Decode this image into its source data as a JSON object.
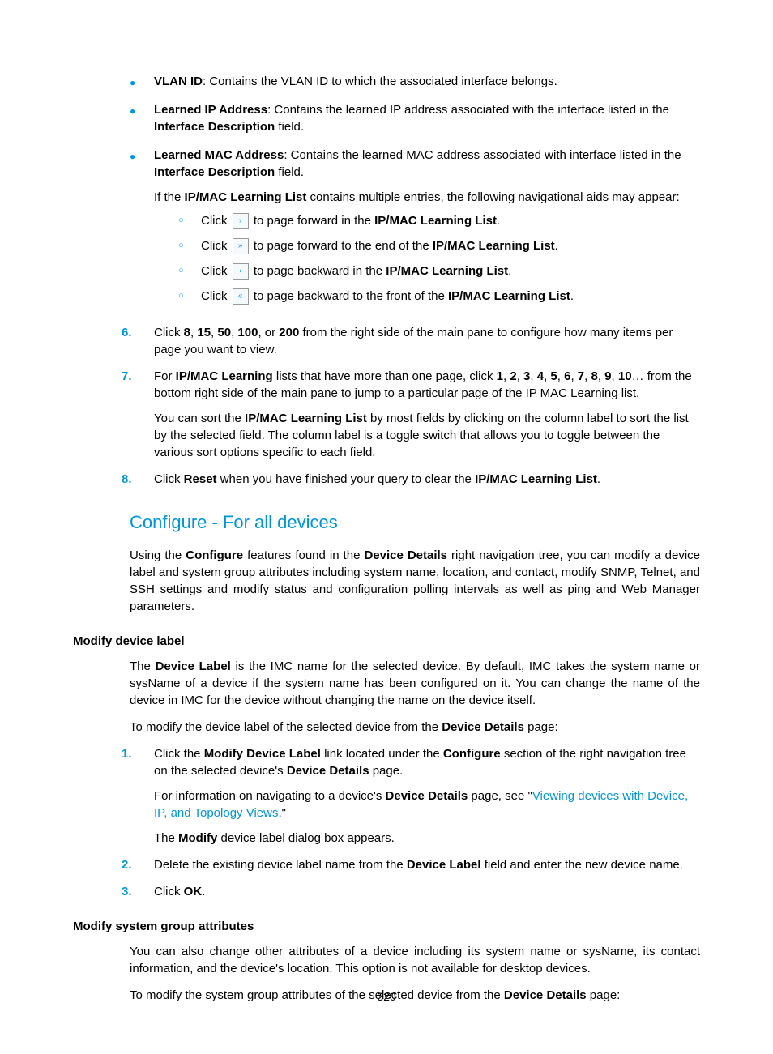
{
  "topBullets": [
    {
      "term": "VLAN ID",
      "desc": ": Contains the VLAN ID to which the associated interface belongs."
    },
    {
      "term": "Learned IP Address",
      "desc": ": Contains the learned IP address associated with the interface listed in the ",
      "tail": " field.",
      "tailBold": "Interface Description"
    },
    {
      "term": "Learned MAC Address",
      "desc": ": Contains the learned MAC address associated with interface listed in the ",
      "tail": " field.",
      "tailBold": "Interface Description"
    }
  ],
  "navIntro": {
    "pre": "If the ",
    "bold": "IP/MAC Learning List",
    "post": " contains multiple entries, the following navigational aids may appear:"
  },
  "navItems": [
    {
      "clickWord": "Click ",
      "iconGlyph": "›",
      "mid": " to page forward in the ",
      "bold": "IP/MAC Learning List",
      "end": "."
    },
    {
      "clickWord": "Click ",
      "iconGlyph": "»",
      "mid": " to page forward to the end of the ",
      "bold": "IP/MAC Learning List",
      "end": "."
    },
    {
      "clickWord": "Click ",
      "iconGlyph": "‹",
      "mid": " to page backward in the ",
      "bold": "IP/MAC Learning List",
      "end": "."
    },
    {
      "clickWord": "Click ",
      "iconGlyph": "«",
      "mid": " to page backward to the front of the ",
      "bold": "IP/MAC Learning List",
      "end": "."
    }
  ],
  "step6": {
    "num": "6.",
    "pre": "Click ",
    "nums": [
      "8",
      "15",
      "50",
      "100",
      "200"
    ],
    "or": ", or ",
    "post": " from the right side of the main pane to configure how many items per page you want to view."
  },
  "step7": {
    "num": "7.",
    "pre": "For ",
    "bold1": "IP/MAC Learning",
    "mid1": " lists that have more than one page, click ",
    "nums": [
      "1",
      "2",
      "3",
      "4",
      "5",
      "6",
      "7",
      "8",
      "9",
      "10"
    ],
    "ellipsis": "… from the bottom right side of the main pane to jump to a particular page of the IP MAC Learning list.",
    "p2pre": "You can sort the ",
    "p2bold": "IP/MAC Learning List",
    "p2post": " by most fields by clicking on the column label to sort the list by the selected field. The column label is a toggle switch that allows you to toggle between the various sort options specific to each field."
  },
  "step8": {
    "num": "8.",
    "pre": "Click ",
    "bold1": "Reset",
    "mid": " when you have finished your query to clear the ",
    "bold2": "IP/MAC Learning List",
    "end": "."
  },
  "h2": "Configure - For all devices",
  "configIntro": {
    "pre": "Using the ",
    "b1": "Configure",
    "mid1": " features found in the ",
    "b2": "Device Details",
    "post": " right navigation tree, you can modify a device label and system group attributes including system name, location, and contact, modify SNMP, Telnet, and SSH settings and modify status and configuration polling intervals as well as ping and Web Manager parameters."
  },
  "h3a": "Modify device label",
  "mdlPara1": {
    "pre": "The ",
    "b1": "Device Label",
    "post": " is the IMC name for the selected device. By default, IMC takes the system name or sysName of a device if the system name has been configured on it. You can change the name of the device in IMC for the device without changing the name on the device itself."
  },
  "mdlPara2": {
    "pre": "To modify the device label of the selected device from the ",
    "b1": "Device Details",
    "post": " page:"
  },
  "mdlStep1": {
    "num": "1.",
    "pre": "Click the ",
    "b1": "Modify Device Label",
    "mid1": " link located under the ",
    "b2": "Configure",
    "mid2": " section of the right navigation tree on the selected device's ",
    "b3": "Device Details",
    "end": " page.",
    "p2pre": "For information on navigating to a device's ",
    "p2b": "Device Details",
    "p2mid": " page, see \"",
    "p2link": "Viewing devices with Device, IP, and Topology Views",
    "p2end": ".\"",
    "p3pre": "The ",
    "p3b": "Modify",
    "p3post": " device label dialog box appears."
  },
  "mdlStep2": {
    "num": "2.",
    "pre": "Delete the existing device label name from the ",
    "b1": "Device Label",
    "post": " field and enter the new device name."
  },
  "mdlStep3": {
    "num": "3.",
    "pre": "Click ",
    "b1": "OK",
    "post": "."
  },
  "h3b": "Modify system group attributes",
  "msgPara1": "You can also change other attributes of a device including its system name or sysName, its contact information, and the device's location. This option is not available for desktop devices.",
  "msgPara2": {
    "pre": "To modify the system group attributes of the selected device from the ",
    "b1": "Device Details",
    "post": " page:"
  },
  "pageNumber": "320",
  "sep": ", "
}
